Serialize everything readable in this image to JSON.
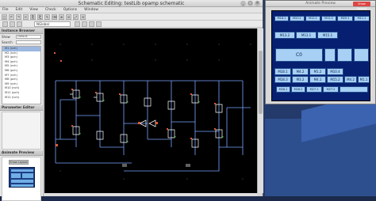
{
  "main_window": {
    "title": "Schematic Editing: testLib opamp schematic",
    "controls": [
      "_",
      "□",
      "×"
    ],
    "menu": [
      "File",
      "Edit",
      "View",
      "Check",
      "Options",
      "Window"
    ],
    "toolbar_glyphs": [
      "▢",
      "↶",
      "↷",
      "✂",
      "⎘",
      "⎗",
      "✎",
      "⌫",
      "⊕",
      "⊖",
      "⤢",
      "⟲"
    ],
    "cell_select_value": "NGlobal"
  },
  "sidebar": {
    "browser_title": "Instance Browser",
    "show_label": "Show",
    "show_value": "Default",
    "search_label": "Search",
    "search_value": "",
    "cells": [
      "M1 (nch)",
      "M2 (nch)",
      "M3 (pch)",
      "M4 (pch)",
      "M5 (nch)",
      "M6 (pch)",
      "M7 (nch)",
      "M8 (pch)",
      "M9 (nch)",
      "M10 (nch)",
      "M11 (pch)",
      "M12 (nch)"
    ],
    "selected_index": 0,
    "param_title": "Parameter Editor",
    "preview_title": "Animate Preview",
    "show_layout_label": "Show Layout"
  },
  "preview_window": {
    "title": "Animate Preview",
    "button": "Show Layout",
    "blocks": [
      "M18.1",
      "M20.1",
      "M12.1",
      "M12.2",
      "M20.1",
      "M11.1",
      "M13.2",
      "M13.1",
      "M15.1",
      "C0",
      "M18.1",
      "M4.2",
      "M1.2",
      "M10.4",
      "M18.3",
      "M3.2",
      "M4.1",
      "M15.2",
      "M4.2",
      "M1.1",
      "M28.1",
      "M28.2",
      "M27.1",
      "M27.2"
    ]
  },
  "colors": {
    "accent": "#d44444",
    "canvas": "#000000",
    "block_fill": "#a7d0f4",
    "layout_bg": "#061f70"
  }
}
